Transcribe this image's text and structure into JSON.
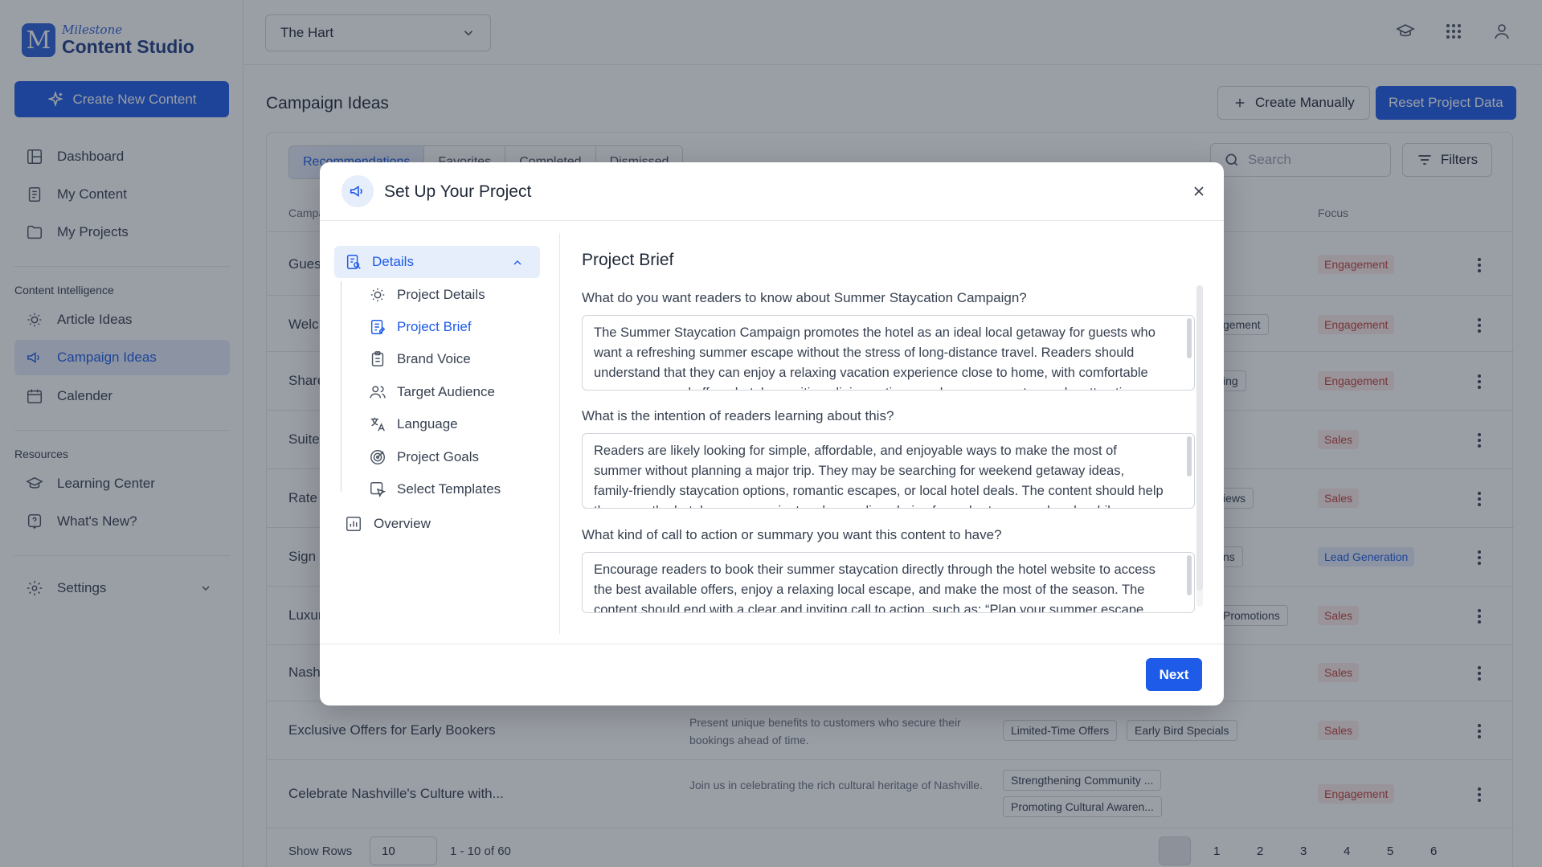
{
  "sidebar": {
    "logo_top": "Milestone",
    "logo_bottom": "Content Studio",
    "logo_mark": "M",
    "create_button": "Create New Content",
    "items": [
      {
        "label": "Dashboard",
        "icon": "dashboard-icon"
      },
      {
        "label": "My Content",
        "icon": "document-icon"
      },
      {
        "label": "My Projects",
        "icon": "folder-icon"
      }
    ],
    "section_intel": "Content Intelligence",
    "intel_items": [
      {
        "label": "Article Ideas",
        "icon": "lightbulb-icon"
      },
      {
        "label": "Campaign Ideas",
        "icon": "megaphone-icon"
      },
      {
        "label": "Calender",
        "icon": "calendar-icon"
      }
    ],
    "section_resources": "Resources",
    "resource_items": [
      {
        "label": "Learning Center",
        "icon": "graduation-cap-icon"
      },
      {
        "label": "What's New?",
        "icon": "help-icon"
      }
    ],
    "settings": "Settings"
  },
  "topbar": {
    "hotel": "The Hart"
  },
  "main": {
    "title": "Campaign Ideas",
    "create_manually": "Create Manually",
    "reset": "Reset Project Data",
    "tabs": [
      "Recommendations",
      "Favorites",
      "Completed",
      "Dismissed"
    ],
    "search_placeholder": "Search",
    "filters": "Filters",
    "columns": {
      "campaign": "Campa",
      "focus": "Focus"
    },
    "rows": [
      {
        "title": "Gues",
        "focus": "Engagement"
      },
      {
        "title": "Welc",
        "tag": "gement",
        "focus": "Engagement"
      },
      {
        "title": "Share",
        "tag": "ing",
        "focus": "Engagement"
      },
      {
        "title": "Suite",
        "focus": "Sales"
      },
      {
        "title": "Rate",
        "tag": "iews",
        "focus": "Sales"
      },
      {
        "title": "Sign",
        "tag": "ns",
        "focus": "Lead Generation"
      },
      {
        "title": "Luxur",
        "tag": "Promotions",
        "focus": "Sales"
      },
      {
        "title": "Nash",
        "focus": "Sales"
      },
      {
        "title": "Exclusive Offers for Early Bookers",
        "desc": "Present unique benefits to customers who secure their bookings ahead of time.",
        "tags": [
          "Limited-Time Offers",
          "Early Bird Specials"
        ],
        "focus": "Sales"
      },
      {
        "title": "Celebrate Nashville's Culture with...",
        "desc": "Join us in celebrating the rich cultural heritage of Nashville.",
        "tags": [
          "Strengthening Community ...",
          "Promoting Cultural Awaren..."
        ],
        "focus": "Engagement"
      }
    ],
    "show_rows_label": "Show Rows",
    "rows_per_page": "10",
    "range": "1 - 10 of 60",
    "pages": [
      "1",
      "2",
      "3",
      "4",
      "5",
      "6"
    ]
  },
  "modal": {
    "title": "Set Up Your Project",
    "group": "Details",
    "steps": [
      {
        "label": "Project Details",
        "icon": "lightbulb-icon"
      },
      {
        "label": "Project Brief",
        "icon": "document-edit-icon"
      },
      {
        "label": "Brand Voice",
        "icon": "clipboard-icon"
      },
      {
        "label": "Target Audience",
        "icon": "users-icon"
      },
      {
        "label": "Language",
        "icon": "translate-icon"
      },
      {
        "label": "Project Goals",
        "icon": "target-icon"
      },
      {
        "label": "Select Templates",
        "icon": "template-cursor-icon"
      }
    ],
    "overview": "Overview",
    "content_title": "Project Brief",
    "q1": "What do you want readers to know about Summer Staycation Campaign?",
    "a1": "The Summer Staycation Campaign promotes the hotel as an ideal local getaway for guests who want a refreshing summer escape without the stress of long-distance travel. Readers should understand that they can enjoy a relaxing vacation experience close to home, with comfortable rooms, seasonal offers, hotel amenities, dining options, and easy access to nearby attractions.",
    "q2": "What is the intention of readers learning about this?",
    "a2": "Readers are likely looking for simple, affordable, and enjoyable ways to make the most of summer without planning a major trip. They may be searching for weekend getaway ideas, family-friendly staycation options, romantic escapes, or local hotel deals. The content should help them see the hotel as a convenient and appealing choice for a short summer break, while encouraging them to",
    "q3": "What kind of call to action or summary you want this content to have?",
    "a3": "Encourage readers to book their summer staycation directly through the hotel website to access the best available offers, enjoy a relaxing local escape, and make the most of the season. The content should end with a clear and inviting call to action, such as: “Plan your summer escape",
    "next": "Next"
  },
  "colors": {
    "accent": "#1d5be8",
    "focus_red": "#c2413a"
  }
}
